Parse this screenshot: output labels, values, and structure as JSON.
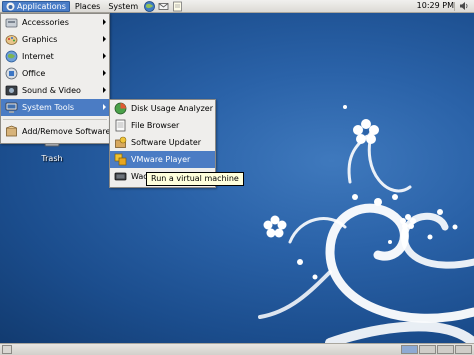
{
  "top_panel": {
    "menus": [
      {
        "label": "Applications",
        "active": true
      },
      {
        "label": "Places",
        "active": false
      },
      {
        "label": "System",
        "active": false
      }
    ],
    "clock": "10:29 PM"
  },
  "desktop": {
    "icons": [
      {
        "label": "Trash",
        "icon": "trash-icon"
      }
    ]
  },
  "applications_menu": {
    "items": [
      {
        "label": "Accessories",
        "icon": "accessories-icon",
        "submenu": true
      },
      {
        "label": "Graphics",
        "icon": "graphics-icon",
        "submenu": true
      },
      {
        "label": "Internet",
        "icon": "internet-icon",
        "submenu": true
      },
      {
        "label": "Office",
        "icon": "office-icon",
        "submenu": true
      },
      {
        "label": "Sound & Video",
        "icon": "sound-video-icon",
        "submenu": true
      },
      {
        "label": "System Tools",
        "icon": "system-tools-icon",
        "submenu": true,
        "highlighted": true
      },
      {
        "label": "Add/Remove Software",
        "icon": "add-remove-software-icon",
        "submenu": false
      }
    ]
  },
  "system_tools_menu": {
    "items": [
      {
        "label": "Disk Usage Analyzer",
        "icon": "disk-usage-analyzer-icon"
      },
      {
        "label": "File Browser",
        "icon": "file-browser-icon"
      },
      {
        "label": "Software Updater",
        "icon": "software-updater-icon"
      },
      {
        "label": "VMware Player",
        "icon": "vmware-player-icon",
        "highlighted": true
      },
      {
        "label": "Wacom",
        "icon": "wacom-icon"
      }
    ]
  },
  "tooltip": {
    "text": "Run a virtual machine"
  },
  "colors": {
    "highlight": "#4b7cc4",
    "desktop_blue": "#2a62a8",
    "menu_bg": "#efeeec"
  }
}
